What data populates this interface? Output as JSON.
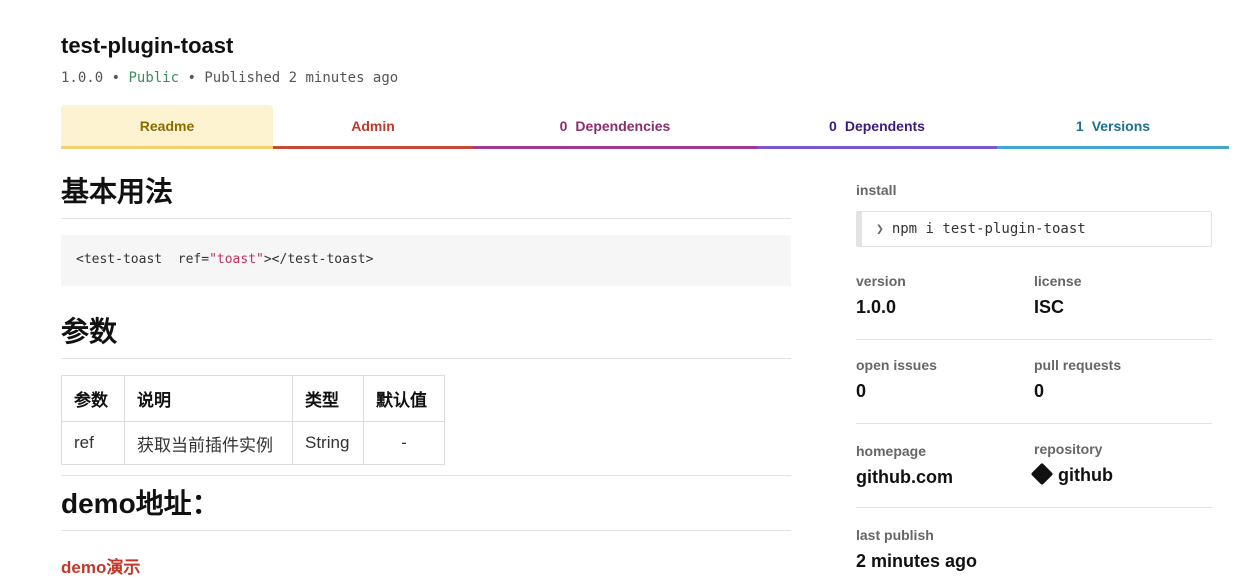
{
  "package": {
    "name": "test-plugin-toast",
    "version": "1.0.0",
    "visibility": "Public",
    "published": "Published 2 minutes ago",
    "separator": "•"
  },
  "tabs": {
    "readme": "Readme",
    "admin": "Admin",
    "dependencies": {
      "count": "0",
      "label": "Dependencies"
    },
    "dependents": {
      "count": "0",
      "label": "Dependents"
    },
    "versions": {
      "count": "1",
      "label": "Versions"
    }
  },
  "readme": {
    "section1_title": "基本用法",
    "code_prefix": "<test-toast  ref=",
    "code_string": "\"toast\"",
    "code_suffix": "></test-toast>",
    "section2_title": "参数",
    "table": {
      "headers": [
        "参数",
        "说明",
        "类型",
        "默认值"
      ],
      "row": [
        "ref",
        "获取当前插件实例",
        "String",
        "-"
      ]
    },
    "section3_title": "demo地址：",
    "demo_link": "demo演示"
  },
  "sidebar": {
    "install_label": "install",
    "install_command": "npm i test-plugin-toast",
    "version_label": "version",
    "version_value": "1.0.0",
    "license_label": "license",
    "license_value": "ISC",
    "open_issues_label": "open issues",
    "open_issues_value": "0",
    "pull_requests_label": "pull requests",
    "pull_requests_value": "0",
    "homepage_label": "homepage",
    "homepage_value": "github.com",
    "repository_label": "repository",
    "repository_value": "github",
    "last_publish_label": "last publish",
    "last_publish_value": "2 minutes ago"
  },
  "colors": {
    "public": "#3a8c5e",
    "readme_tab_bg": "#fdf3d0",
    "demo_link": "#c0392b"
  }
}
